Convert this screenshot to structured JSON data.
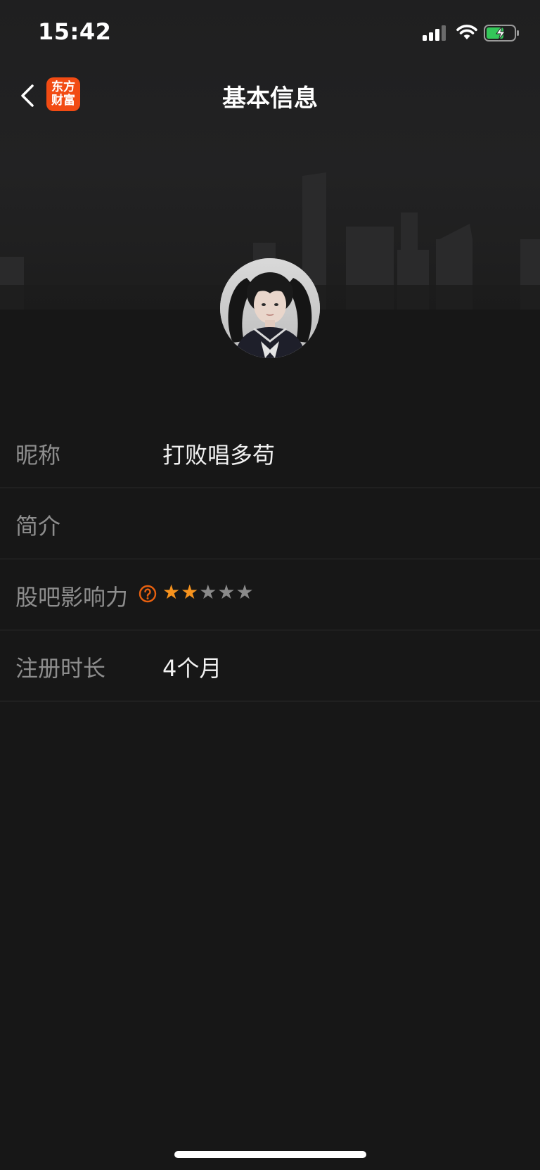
{
  "status_bar": {
    "time": "15:42"
  },
  "nav": {
    "title": "基本信息",
    "logo_line1": "东方",
    "logo_line2": "财富",
    "logo_color": "#f24b13"
  },
  "profile": {
    "rows": {
      "nickname": {
        "label": "昵称",
        "value": "打败唱多苟"
      },
      "bio": {
        "label": "简介",
        "value": ""
      },
      "influence": {
        "label": "股吧影响力",
        "stars_filled": 2,
        "stars_total": 5
      },
      "registered": {
        "label": "注册时长",
        "value": "4个月"
      }
    }
  },
  "colors": {
    "accent": "#f7931e",
    "help_icon": "#e8600f",
    "background": "#171717"
  }
}
